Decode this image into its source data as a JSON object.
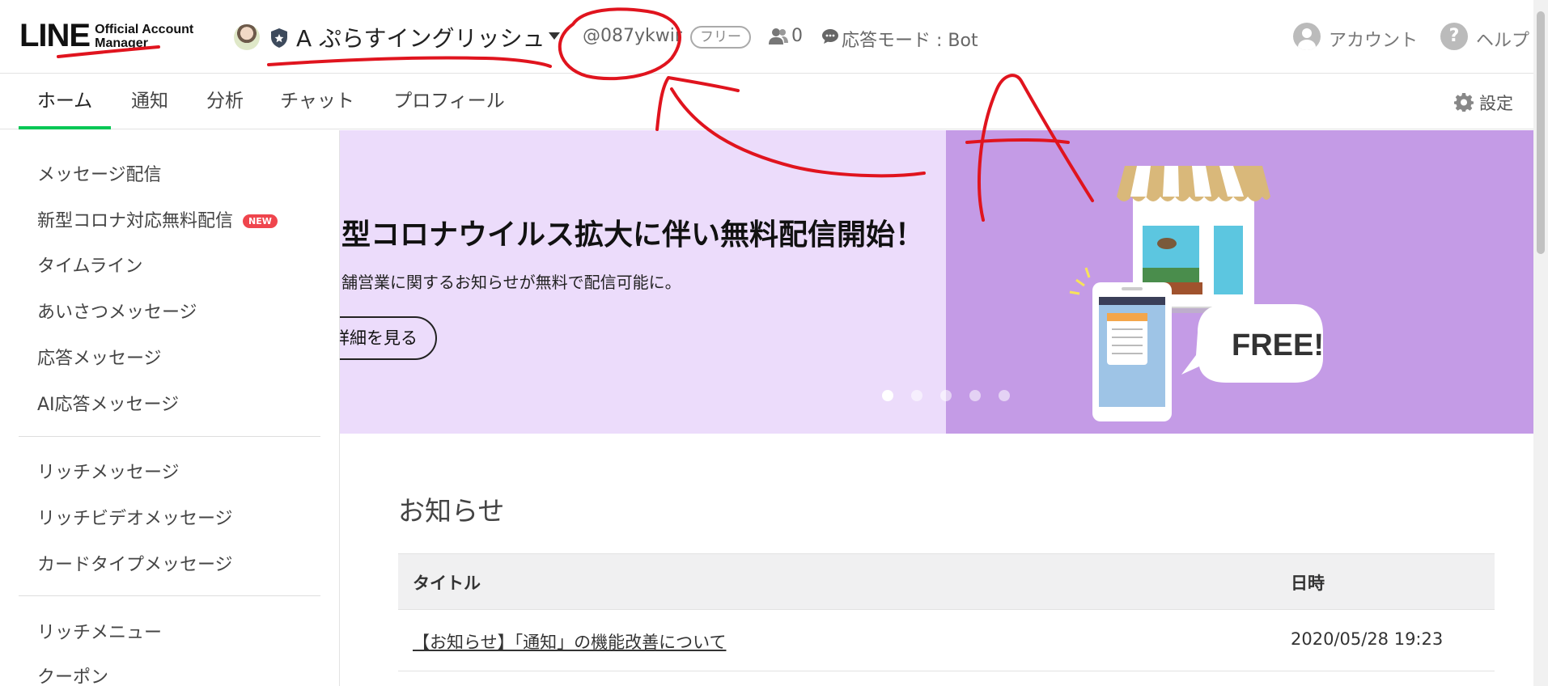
{
  "header": {
    "logo_main": "LINE",
    "logo_sub_1": "Official Account",
    "logo_sub_2": "Manager",
    "account_name": "A ぷらすイングリッシュ",
    "basic_id": "@087ykwir",
    "plan_badge": "フリー",
    "friends_count": "0",
    "response_mode": "応答モード : Bot",
    "account_label": "アカウント",
    "help_label": "ヘルプ"
  },
  "nav": {
    "tabs": [
      {
        "label": "ホーム",
        "active": true
      },
      {
        "label": "通知"
      },
      {
        "label": "分析"
      },
      {
        "label": "チャット"
      },
      {
        "label": "プロフィール"
      }
    ],
    "settings_label": "設定"
  },
  "sidebar": {
    "items": [
      {
        "label": "メッセージ配信"
      },
      {
        "label": "新型コロナ対応無料配信",
        "badge": "NEW"
      },
      {
        "label": "タイムライン"
      },
      {
        "label": "あいさつメッセージ"
      },
      {
        "label": "応答メッセージ"
      },
      {
        "label": "AI応答メッセージ"
      },
      {
        "label": "リッチメッセージ"
      },
      {
        "label": "リッチビデオメッセージ"
      },
      {
        "label": "カードタイプメッセージ"
      },
      {
        "label": "リッチメニュー"
      },
      {
        "label": "クーポン"
      }
    ]
  },
  "banner": {
    "headline": "型コロナウイルス拡大に伴い無料配信開始！",
    "subtext": "舗営業に関するお知らせが無料で配信可能に。",
    "button_label": "詳細を見る",
    "illustration_text": "FREE!",
    "slide_count": 5,
    "active_slide": 1,
    "left_color": "#ecdcfb",
    "right_color": "#c49be6"
  },
  "notices": {
    "title": "お知らせ",
    "columns": [
      "タイトル",
      "日時"
    ],
    "rows": [
      {
        "title": "【お知らせ】「通知」の機能改善について",
        "date": "2020/05/28 19:23"
      }
    ]
  },
  "colors": {
    "accent": "#06c755",
    "new_badge": "#ef454d",
    "annotation": "#e0141e"
  }
}
